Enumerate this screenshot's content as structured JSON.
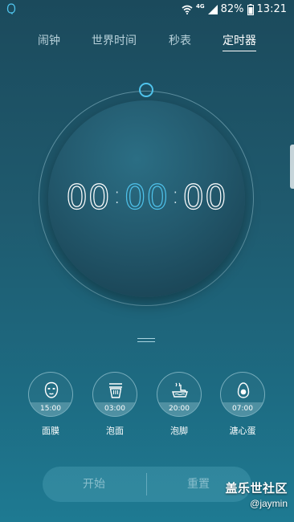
{
  "status_bar": {
    "left_icon": "app-notification-icon",
    "network": "4G",
    "battery": "82%",
    "time": "13:21",
    "icons": [
      "wifi-icon",
      "signal-icon",
      "battery-icon"
    ]
  },
  "tabs": [
    {
      "label": "闹钟",
      "active": false
    },
    {
      "label": "世界时间",
      "active": false
    },
    {
      "label": "秒表",
      "active": false
    },
    {
      "label": "定时器",
      "active": true
    }
  ],
  "timer": {
    "hours": "00",
    "minutes": "00",
    "seconds": "00",
    "separator": ":"
  },
  "presets": [
    {
      "label": "面膜",
      "time": "15:00",
      "icon": "face-mask-icon"
    },
    {
      "label": "泡面",
      "time": "03:00",
      "icon": "noodles-cup-icon"
    },
    {
      "label": "泡脚",
      "time": "20:00",
      "icon": "foot-bath-icon"
    },
    {
      "label": "溏心蛋",
      "time": "07:00",
      "icon": "egg-icon"
    }
  ],
  "controls": {
    "start_label": "开始",
    "reset_label": "重置"
  },
  "watermark": {
    "title": "盖乐世社区",
    "user": "@jaymin"
  },
  "colors": {
    "accent": "#4fc3ec",
    "background_top": "#1b4a5c",
    "background_bottom": "#1e7a92"
  }
}
